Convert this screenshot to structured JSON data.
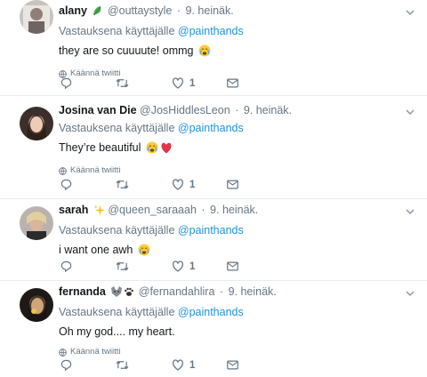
{
  "tweets": [
    {
      "name": "alany",
      "handle": "@outtaystyle",
      "date": "9. heinäk.",
      "reply_prefix": "Vastauksena käyttäjälle",
      "reply_to": "@painthands",
      "text": "they are so cuuuute! ommg",
      "translate": "Käännä twiitti",
      "likes": "1",
      "name_icon": "plant-icon",
      "text_emojis": [
        "crying-face-emoji"
      ]
    },
    {
      "name": "Josina van Die",
      "handle": "@JosHiddlesLeon",
      "date": "9. heinäk.",
      "reply_prefix": "Vastauksena käyttäjälle",
      "reply_to": "@painthands",
      "text": "They’re beautiful",
      "translate": "Käännä twiitti",
      "likes": "1",
      "name_icon": "",
      "text_emojis": [
        "crying-face-emoji",
        "red-heart-emoji"
      ]
    },
    {
      "name": "sarah",
      "handle": "@queen_saraaah",
      "date": "9. heinäk.",
      "reply_prefix": "Vastauksena käyttäjälle",
      "reply_to": "@painthands",
      "text": "i want one awh",
      "translate": "",
      "likes": "1",
      "name_icon": "sparkles-icon",
      "text_emojis": [
        "crying-face-emoji"
      ]
    },
    {
      "name": "fernanda",
      "handle": "@fernandahlira",
      "date": "9. heinäk.",
      "reply_prefix": "Vastauksena käyttäjälle",
      "reply_to": "@painthands",
      "text": "Oh my god.... my heart.",
      "translate": "Käännä twiitti",
      "likes": "1",
      "name_icon": "wolf-paw-icon",
      "text_emojis": []
    }
  ],
  "colors": {
    "link": "#1b95e0",
    "secondary_text": "#657786",
    "divider": "#e6ecf0"
  }
}
